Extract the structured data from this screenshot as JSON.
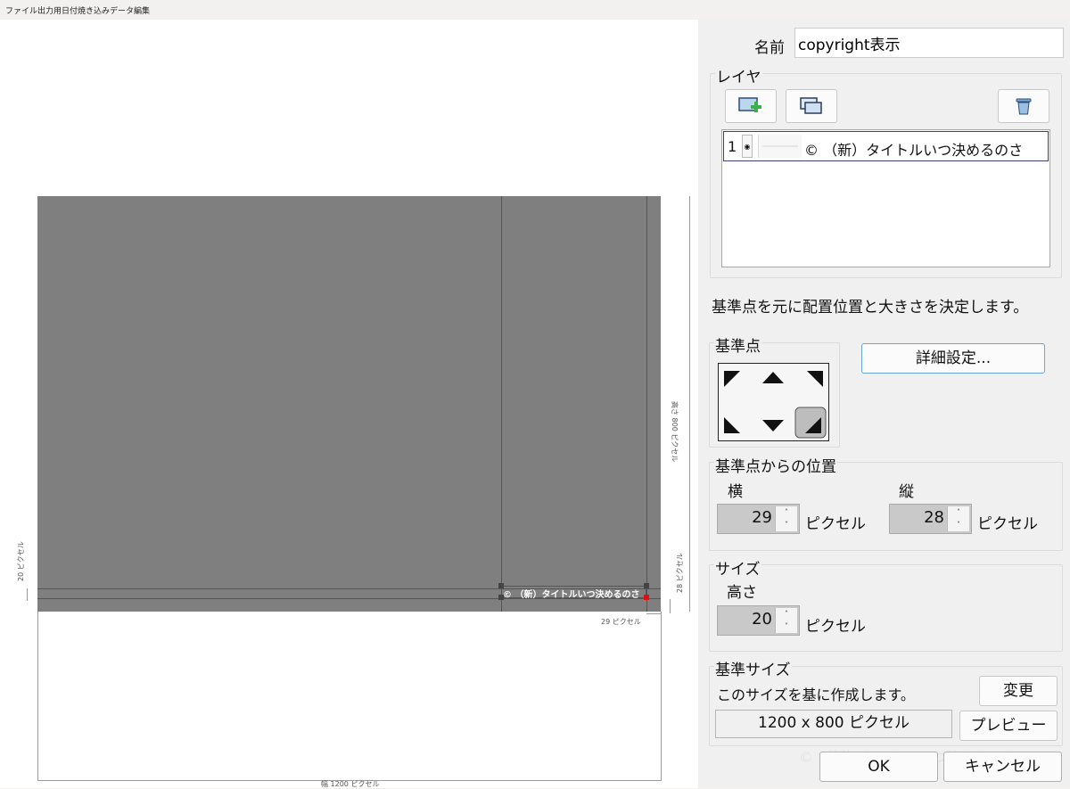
{
  "window": {
    "title": "ファイル出力用日付焼き込みデータ編集"
  },
  "canvas": {
    "overlay_text": "© （新）タイトルいつ決めるのさ",
    "dim_height_20": "20 ピクセル",
    "dim_height_800": "高さ 800 ピクセル",
    "dim_offset_28": "28 ピクセル",
    "dim_offset_29": "29 ピクセル",
    "dim_width_1200": "幅 1200 ピクセル"
  },
  "name_field": {
    "label": "名前",
    "value": "copyright表示"
  },
  "layer": {
    "group_label": "レイヤ",
    "add_icon": "add-layer-icon",
    "duplicate_icon": "duplicate-layer-icon",
    "delete_icon": "trash-icon",
    "items": [
      {
        "index": "1",
        "text": "© （新）タイトルいつ決めるのさ"
      }
    ]
  },
  "description": "基準点を元に配置位置と大きさを決定します。",
  "anchor": {
    "group_label": "基準点",
    "selected": "bottom-right"
  },
  "detail_button": "詳細設定...",
  "position": {
    "group_label": "基準点からの位置",
    "horizontal_label": "横",
    "horizontal_value": "29",
    "vertical_label": "縦",
    "vertical_value": "28",
    "unit": "ピクセル"
  },
  "size": {
    "group_label": "サイズ",
    "height_label": "高さ",
    "height_value": "20",
    "unit": "ピクセル"
  },
  "base_size": {
    "group_label": "基準サイズ",
    "description": "このサイズを基に作成します。",
    "change_button": "変更",
    "value": "1200 x 800 ピクセル",
    "preview_button": "プレビュー"
  },
  "footer": {
    "ghost_text": "© （新）タイトルいつ決めるのさ",
    "ok_button": "OK",
    "cancel_button": "キャンセル"
  }
}
